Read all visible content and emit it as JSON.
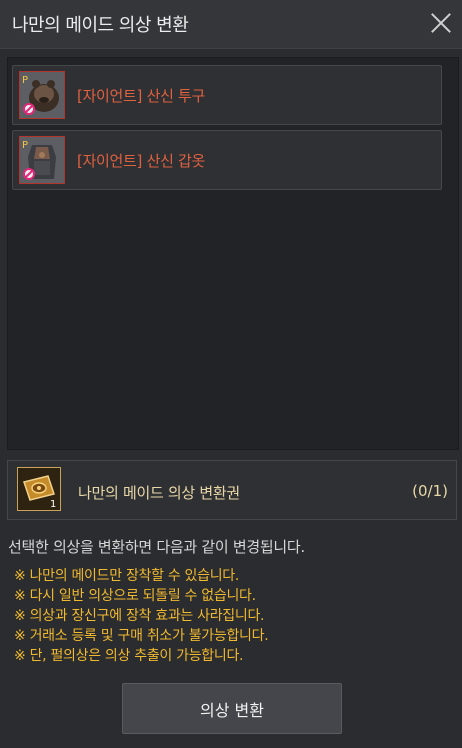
{
  "window": {
    "title": "나만의 메이드 의상 변환"
  },
  "items": [
    {
      "label": "[자이언트] 산신 투구",
      "badge": "P",
      "icon": "helmet-icon"
    },
    {
      "label": "[자이언트] 산신 갑옷",
      "badge": "P",
      "icon": "armor-icon"
    }
  ],
  "ticket": {
    "label": "나만의 메이드 의상 변환권",
    "count": "(0/1)",
    "stack": "1"
  },
  "description": "선택한 의상을 변환하면 다음과 같이 변경됩니다.",
  "notes": [
    "※ 나만의 메이드만 장착할 수 있습니다.",
    "※ 다시 일반 의상으로 되돌릴 수 없습니다.",
    "※ 의상과 장신구에 장착 효과는 사라집니다.",
    "※ 거래소 등록 및 구매 취소가 불가능합니다.",
    "※ 단, 펄의상은 의상 추출이 가능합니다."
  ],
  "button": {
    "label": "의상 변환"
  },
  "colors": {
    "item_text": "#e0613e",
    "note_text": "#f0b92e",
    "ticket_text": "#e8d7a6"
  }
}
